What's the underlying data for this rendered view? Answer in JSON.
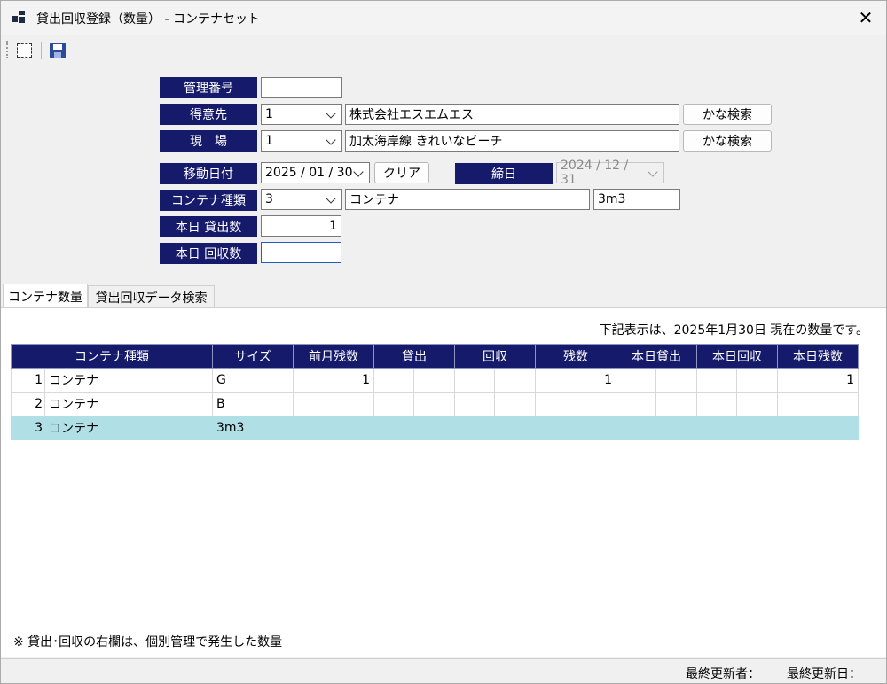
{
  "window": {
    "title": "貸出回収登録（数量） - コンテナセット",
    "close_label": "✕"
  },
  "form": {
    "mgmt_no_label": "管理番号",
    "mgmt_no_value": "",
    "customer_label": "得意先",
    "customer_code": "1",
    "customer_name": "株式会社エスエムエス",
    "customer_search_label": "かな検索",
    "site_label": "現　場",
    "site_code": "1",
    "site_name": "加太海岸線  きれいなビーチ",
    "site_search_label": "かな検索",
    "move_date_label": "移動日付",
    "move_date_value": "2025 / 01 / 30",
    "clear_label": "クリア",
    "closing_label": "締日",
    "closing_value": "2024 / 12 / 31",
    "container_type_label": "コンテナ種類",
    "container_type_code": "3",
    "container_type_name": "コンテナ",
    "container_size": "3m3",
    "today_lend_label": "本日 貸出数",
    "today_lend_value": "1",
    "today_collect_label": "本日 回収数",
    "today_collect_value": ""
  },
  "tabs": [
    {
      "label": "コンテナ数量",
      "active": true
    },
    {
      "label": "貸出回収データ検索",
      "active": false
    }
  ],
  "grid": {
    "caption": "下記表示は、2025年1月30日 現在の数量です。",
    "columns": [
      "コンテナ種類",
      "サイズ",
      "前月残数",
      "貸出",
      "回収",
      "残数",
      "本日貸出",
      "本日回収",
      "本日残数"
    ],
    "rows": [
      {
        "no": "1",
        "type": "コンテナ",
        "size": "G",
        "prev": "1",
        "lend_a": "",
        "lend_b": "",
        "col_a": "",
        "col_b": "",
        "remain": "1",
        "tl_a": "",
        "tl_b": "",
        "tc_a": "",
        "tc_b": "",
        "today_remain": "1"
      },
      {
        "no": "2",
        "type": "コンテナ",
        "size": "B",
        "prev": "",
        "lend_a": "",
        "lend_b": "",
        "col_a": "",
        "col_b": "",
        "remain": "",
        "tl_a": "",
        "tl_b": "",
        "tc_a": "",
        "tc_b": "",
        "today_remain": ""
      },
      {
        "no": "3",
        "type": "コンテナ",
        "size": "3m3",
        "prev": "",
        "lend_a": "",
        "lend_b": "",
        "col_a": "",
        "col_b": "",
        "remain": "",
        "tl_a": "",
        "tl_b": "",
        "tc_a": "",
        "tc_b": "",
        "today_remain": ""
      }
    ],
    "selected_row": 3,
    "selected_color": "#b0e0e6"
  },
  "footnote": "※ 貸出･回収の右欄は、個別管理で発生した数量",
  "status": {
    "updated_by_label": "最終更新者：",
    "updated_date_label": "最終更新日："
  },
  "colors": {
    "label_bg": "#161a6b",
    "header_bg": "#161a6b"
  },
  "icons": {
    "app": "app-icon",
    "new": "new-document-icon",
    "save": "save-floppy-icon",
    "close": "close-icon",
    "dropdown": "chevron-down-icon"
  }
}
